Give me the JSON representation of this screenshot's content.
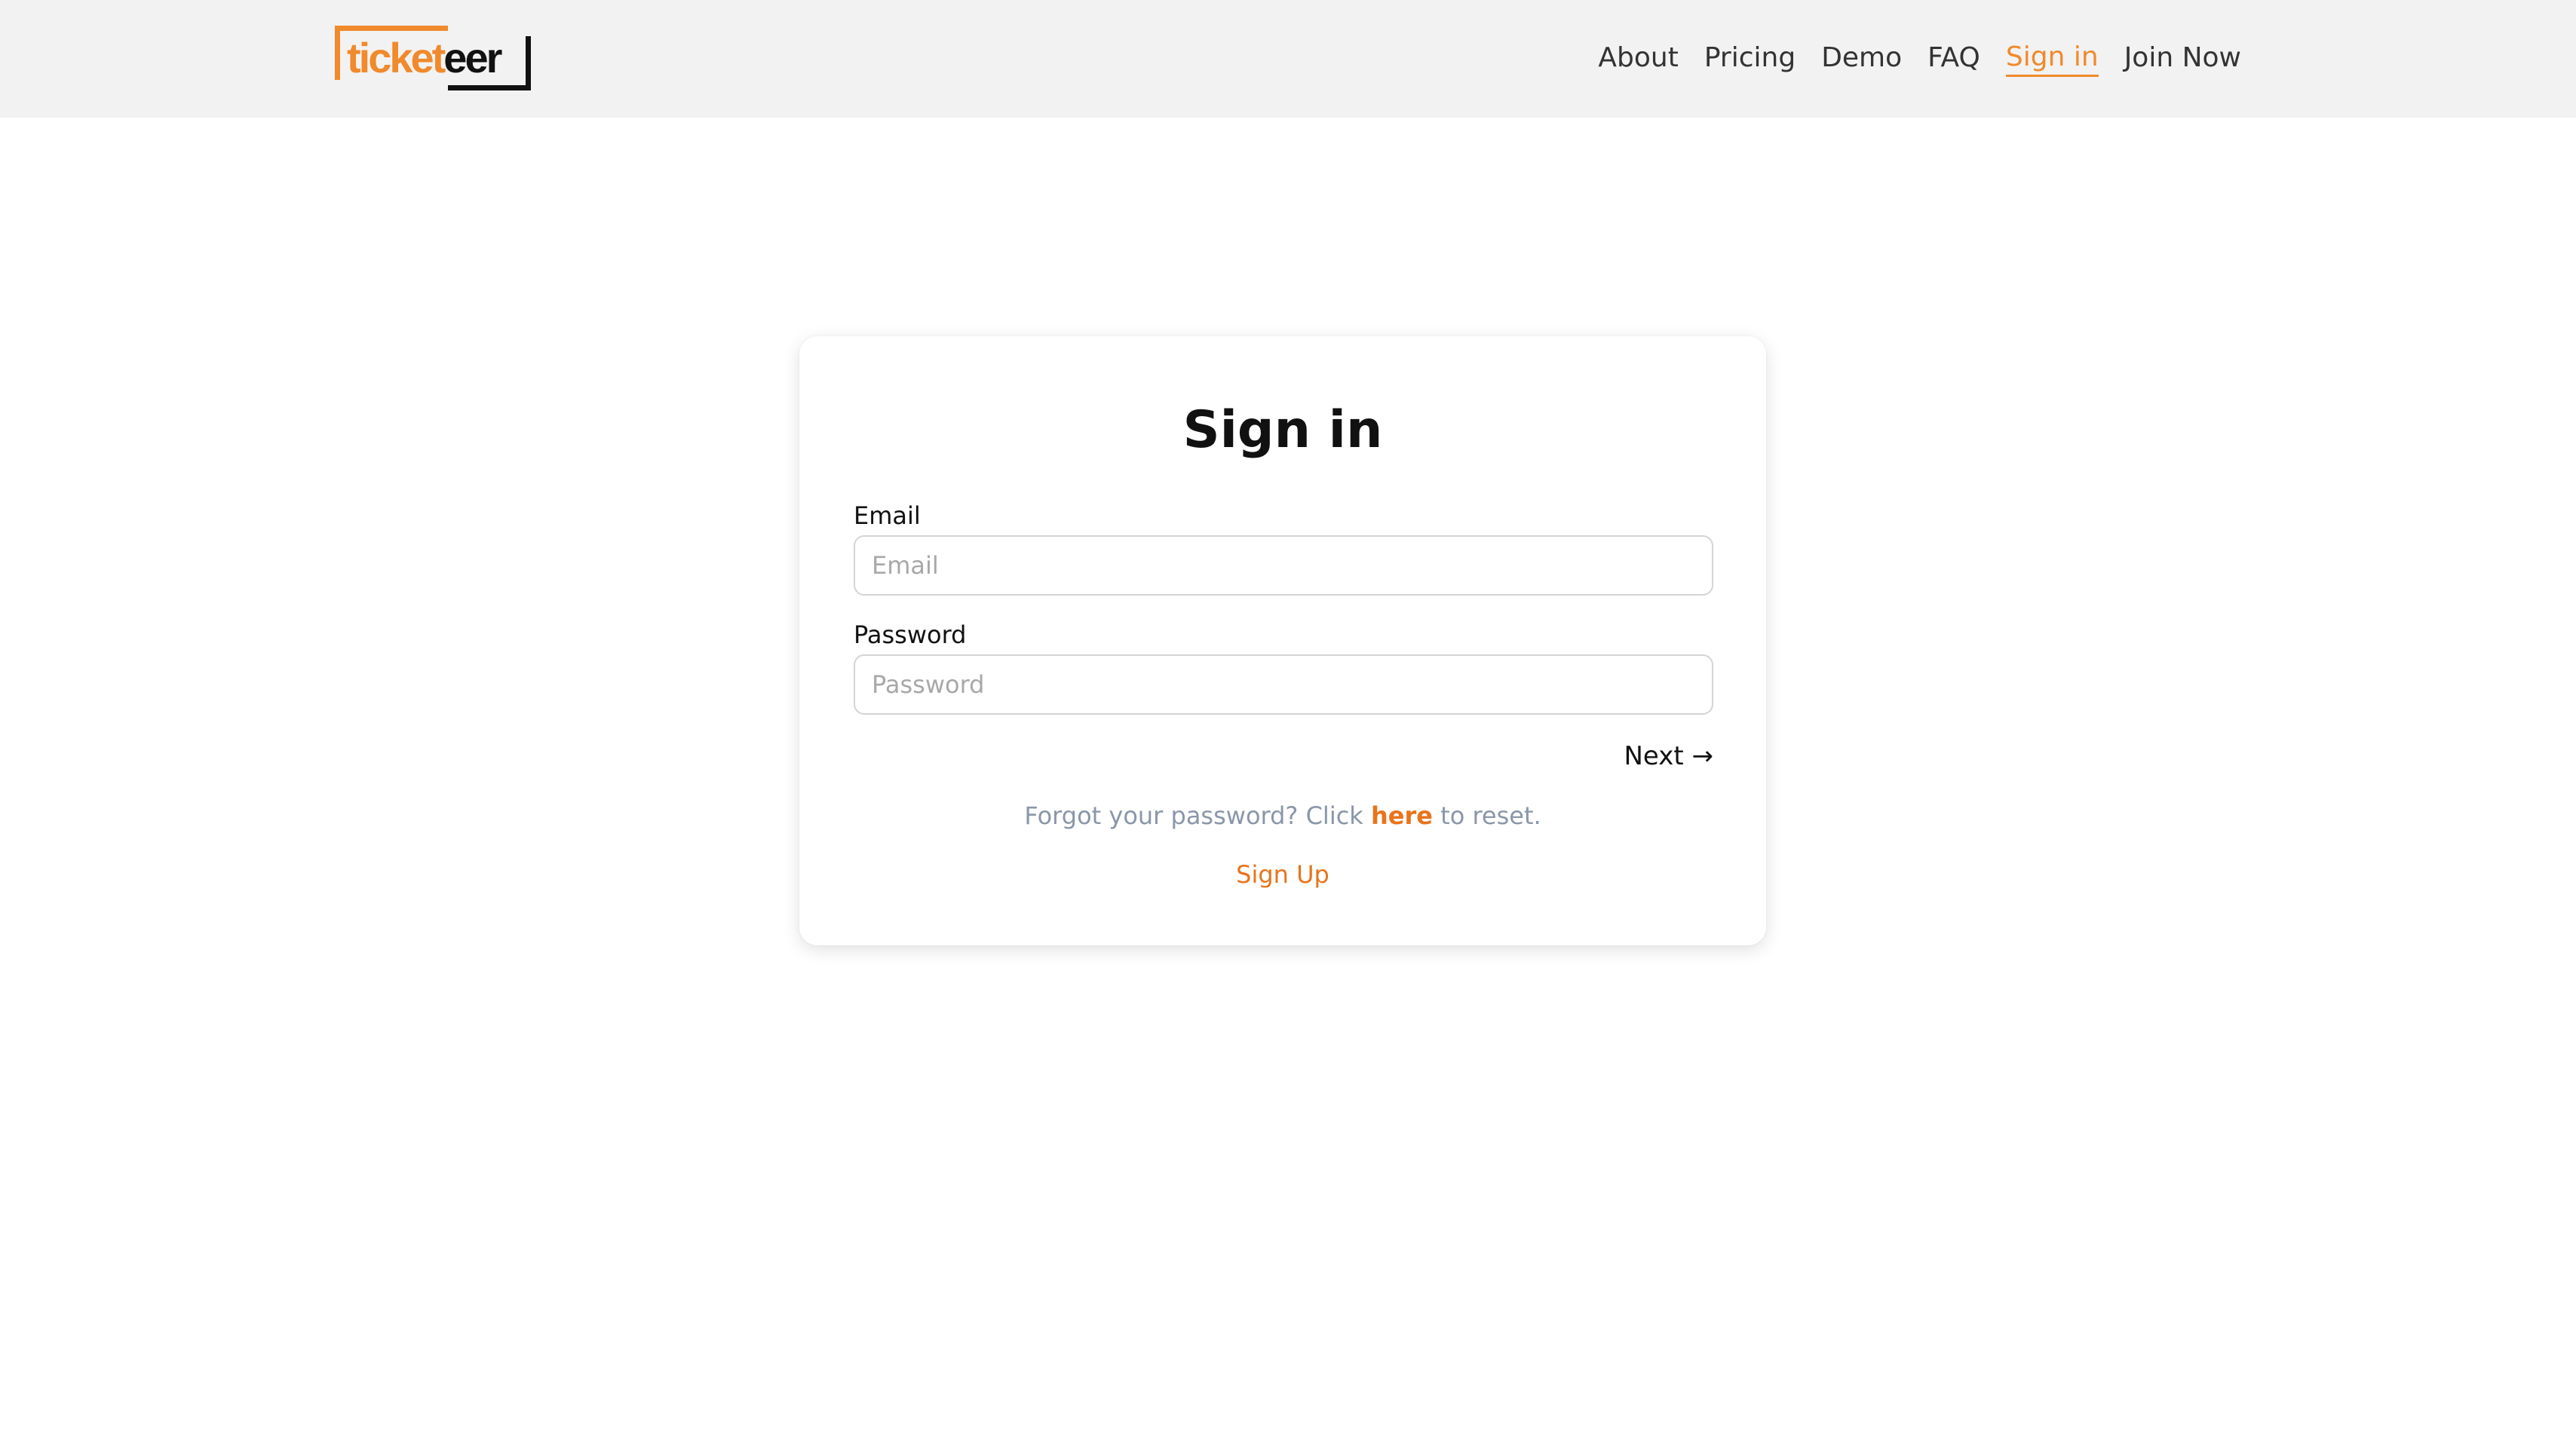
{
  "colors": {
    "accent": "#f08a2c",
    "link": "#e8741c",
    "muted_text": "#8a96aa",
    "header_bg": "#f2f2f2"
  },
  "brand": {
    "logo_text_orange": "ticket",
    "logo_text_dark": "eer"
  },
  "nav": {
    "items": [
      {
        "label": "About"
      },
      {
        "label": "Pricing"
      },
      {
        "label": "Demo"
      },
      {
        "label": "FAQ"
      },
      {
        "label": "Sign in",
        "active": true
      },
      {
        "label": "Join Now"
      }
    ]
  },
  "signin": {
    "title": "Sign in",
    "email_label": "Email",
    "email_placeholder": "Email",
    "email_value": "",
    "password_label": "Password",
    "password_placeholder": "Password",
    "password_value": "",
    "next_label": "Next →",
    "forgot_prefix": "Forgot your password? Click ",
    "forgot_link": "here",
    "forgot_suffix": " to reset.",
    "signup_label": "Sign Up"
  }
}
